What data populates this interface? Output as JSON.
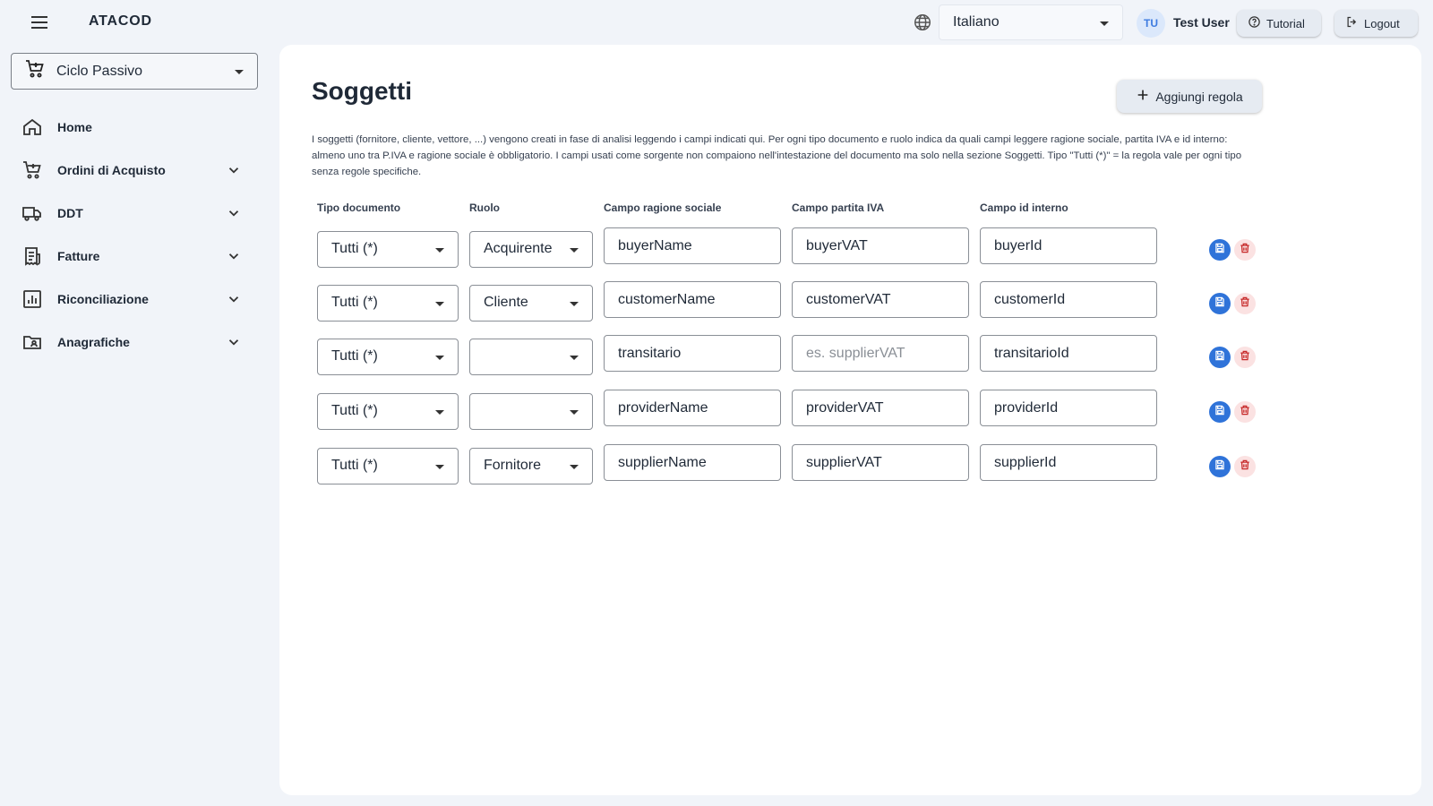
{
  "header": {
    "app_name": "ATACOD",
    "language": "Italiano",
    "user_initials": "TU",
    "user_name": "Test User",
    "tutorial_label": "Tutorial",
    "logout_label": "Logout"
  },
  "sidebar": {
    "cycle": "Ciclo Passivo",
    "items": [
      {
        "label": "Home",
        "icon": "home-icon"
      },
      {
        "label": "Ordini di Acquisto",
        "icon": "cart-icon"
      },
      {
        "label": "DDT",
        "icon": "truck-icon"
      },
      {
        "label": "Fatture",
        "icon": "receipt-icon"
      },
      {
        "label": "Riconciliazione",
        "icon": "chart-icon"
      },
      {
        "label": "Anagrafiche",
        "icon": "folder-user-icon"
      }
    ]
  },
  "main": {
    "title": "Soggetti",
    "add_rule_label": "Aggiungi regola",
    "description": "I soggetti (fornitore, cliente, vettore, ...) vengono creati in fase di analisi leggendo i campi indicati qui. Per ogni tipo documento e ruolo indica da quali campi leggere ragione sociale, partita IVA e id interno: almeno uno tra P.IVA e ragione sociale è obbligatorio. I campi usati come sorgente non compaiono nell'intestazione del documento ma solo nella sezione Soggetti. Tipo \"Tutti (*)\" = la regola vale per ogni tipo senza regole specifiche.",
    "columns": {
      "doc_type": "Tipo documento",
      "role": "Ruolo",
      "name_field": "Campo ragione sociale",
      "vat_field": "Campo partita IVA",
      "id_field": "Campo id interno"
    },
    "rules": [
      {
        "doc_type": "Tutti (*)",
        "role": "Acquirente",
        "name_field": "buyerName",
        "vat_field": "buyerVAT",
        "vat_placeholder": "es. supplierVAT",
        "id_field": "buyerId"
      },
      {
        "doc_type": "Tutti (*)",
        "role": "Cliente",
        "name_field": "customerName",
        "vat_field": "customerVAT",
        "vat_placeholder": "es. supplierVAT",
        "id_field": "customerId"
      },
      {
        "doc_type": "Tutti (*)",
        "role": "",
        "name_field": "transitario",
        "vat_field": "",
        "vat_placeholder": "es. supplierVAT",
        "id_field": "transitarioId"
      },
      {
        "doc_type": "Tutti (*)",
        "role": "",
        "name_field": "providerName",
        "vat_field": "providerVAT",
        "vat_placeholder": "es. supplierVAT",
        "id_field": "providerId"
      },
      {
        "doc_type": "Tutti (*)",
        "role": "Fornitore",
        "name_field": "supplierName",
        "vat_field": "supplierVAT",
        "vat_placeholder": "es. supplierVAT",
        "id_field": "supplierId"
      }
    ]
  }
}
